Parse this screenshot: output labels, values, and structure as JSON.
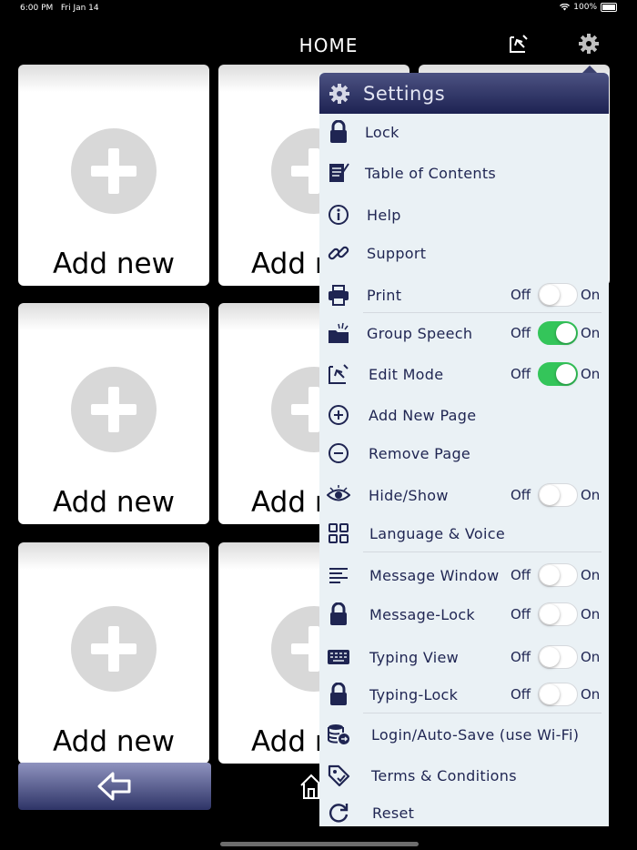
{
  "status_bar": {
    "time": "6:00 PM",
    "date": "Fri Jan 14",
    "battery": "100%"
  },
  "header": {
    "title": "HOME",
    "icons": [
      "edit-mode-icon",
      "gear-icon"
    ]
  },
  "tiles": [
    {
      "label": "Add new"
    },
    {
      "label": "Add new"
    },
    {
      "label": "Add new"
    },
    {
      "label": "Add new"
    },
    {
      "label": "Add new"
    },
    {
      "label": "Add new"
    }
  ],
  "bottom_bar": {
    "back_icon": "back-arrow-icon",
    "home_icon": "home-icon"
  },
  "settings": {
    "title": "Settings",
    "toggle_off_label": "Off",
    "toggle_on_label": "On",
    "items": [
      {
        "label": "Lock",
        "icon": "lock-icon"
      },
      {
        "label": "Table of Contents",
        "icon": "table-of-contents-icon"
      },
      {
        "label": "Help",
        "icon": "info-icon"
      },
      {
        "label": "Support",
        "icon": "link-icon"
      },
      {
        "label": "Print",
        "icon": "printer-icon",
        "toggle": "off"
      },
      {
        "label": "Group Speech",
        "icon": "group-speech-icon",
        "toggle": "on"
      },
      {
        "label": "Edit Mode",
        "icon": "edit-mode-icon",
        "toggle": "on"
      },
      {
        "label": "Add New Page",
        "icon": "plus-circle-icon"
      },
      {
        "label": "Remove Page",
        "icon": "minus-circle-icon"
      },
      {
        "label": "Hide/Show",
        "icon": "eye-icon",
        "toggle": "off"
      },
      {
        "label": "Language & Voice",
        "icon": "grid-icon"
      },
      {
        "label": "Message Window",
        "icon": "lines-icon",
        "toggle": "off"
      },
      {
        "label": "Message-Lock",
        "icon": "lock-icon",
        "toggle": "off"
      },
      {
        "label": "Typing View",
        "icon": "keyboard-icon",
        "toggle": "off"
      },
      {
        "label": "Typing-Lock",
        "icon": "lock-icon",
        "toggle": "off"
      },
      {
        "label": "Login/Auto-Save (use Wi-Fi)",
        "icon": "database-icon"
      },
      {
        "label": "Terms & Conditions",
        "icon": "tag-icon"
      },
      {
        "label": "Reset",
        "icon": "reset-icon"
      }
    ],
    "colors": {
      "header": "#1d2252",
      "panel_bg": "#eaf1f5",
      "toggle_on": "#34c55a",
      "text": "#1f2552"
    }
  }
}
